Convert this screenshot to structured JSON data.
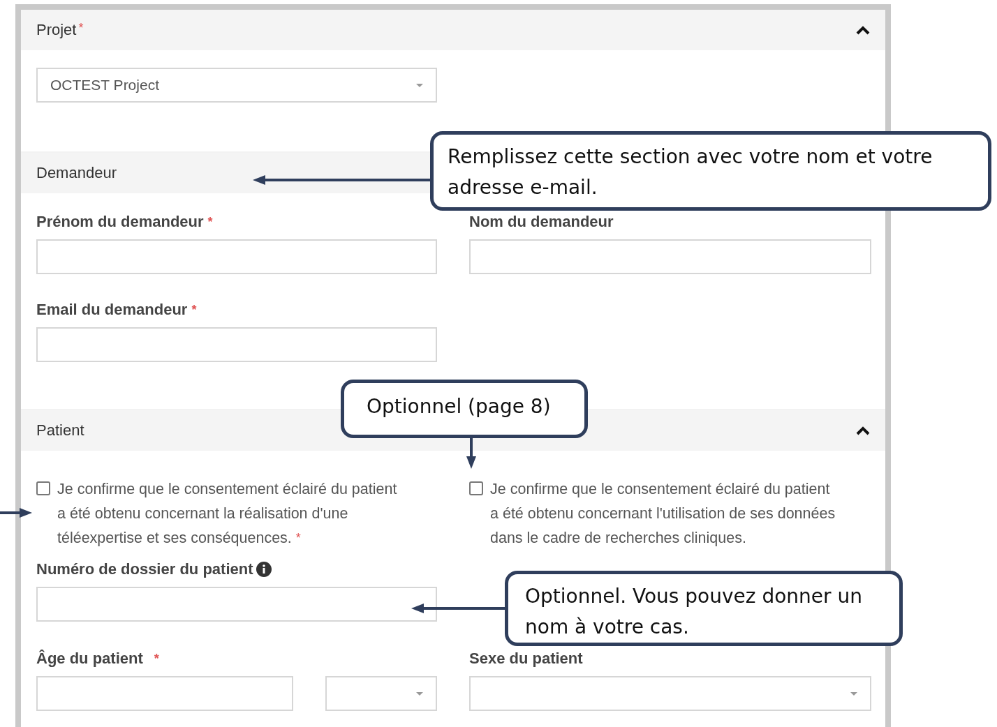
{
  "sections": [
    {
      "title": "Projet",
      "mark": "*",
      "expanded": true,
      "rows": [
        [
          {
            "kind": "select",
            "value": "OCTEST Project"
          }
        ]
      ]
    },
    {
      "title": "Demandeur",
      "rows": [
        [
          {
            "kind": "text",
            "label": "Prénom du demandeur",
            "mark": "*"
          },
          {
            "kind": "text",
            "label": "Nom du demandeur"
          }
        ],
        [
          {
            "kind": "text",
            "label": "Email du demandeur",
            "mark": "*"
          }
        ]
      ]
    },
    {
      "title": "Patient",
      "expanded": true,
      "rows": [
        [
          {
            "kind": "checkbox",
            "checked": false,
            "label": "Je confirme que le consentement éclairé du patient a été obtenu concernant la réalisation d'une téléexpertise et ses conséquences.",
            "mark": "*"
          },
          {
            "kind": "checkbox",
            "checked": false,
            "label": "Je confirme que le consentement éclairé du patient a été obtenu concernant l'utilisation de ses données dans le cadre de recherches cliniques."
          }
        ],
        [
          {
            "kind": "text",
            "label": "Numéro de dossier du patient",
            "info": true
          }
        ],
        [
          {
            "kind": "text-unit",
            "label": "Âge du patient",
            "mark": "*"
          },
          {
            "kind": "select",
            "label": "Sexe du patient"
          }
        ]
      ]
    }
  ],
  "callouts": [
    {
      "text": "Remplissez cette section avec votre nom et votre adresse e-mail."
    },
    {
      "text": "Optionnel (page 8)"
    },
    {
      "text": "Optionnel. Vous pouvez donner un nom à votre cas."
    }
  ]
}
